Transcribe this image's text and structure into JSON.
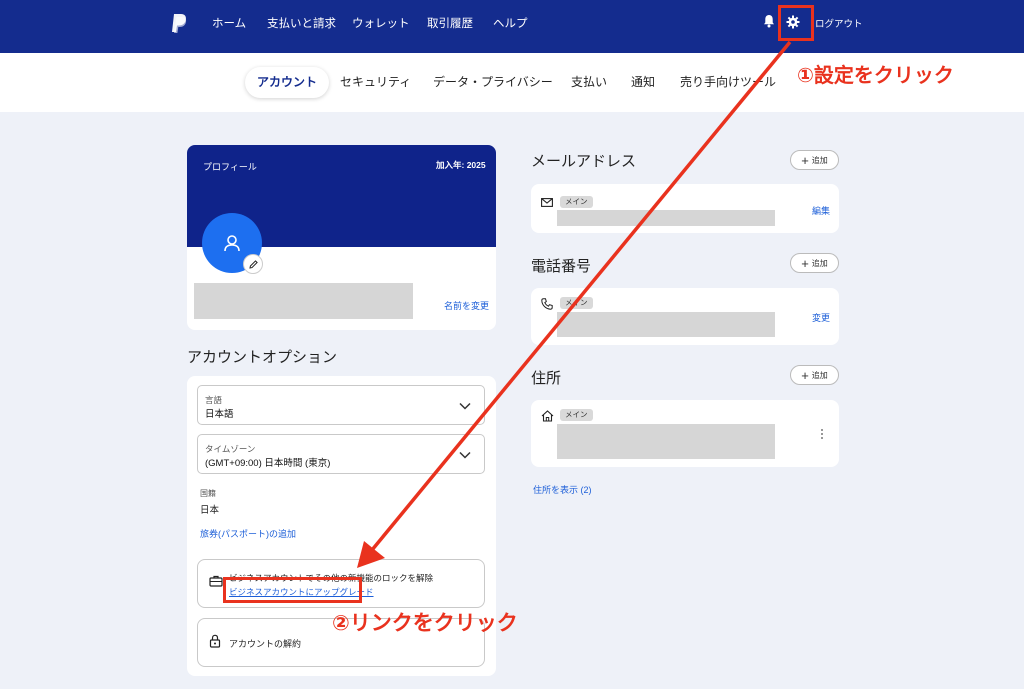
{
  "topnav": {
    "logo": "paypal-logo-icon",
    "items": [
      "ホーム",
      "支払いと請求",
      "ウォレット",
      "取引履歴",
      "ヘルプ"
    ],
    "logout": "ログアウト"
  },
  "tabs": [
    "アカウント",
    "セキュリティ",
    "データ・プライバシー",
    "支払い",
    "通知",
    "売り手向けツール"
  ],
  "profile": {
    "label": "プロフィール",
    "joined": "加入年: 2025",
    "change_name": "名前を変更"
  },
  "account_options": {
    "title": "アカウントオプション",
    "language_label": "言語",
    "language_value": "日本語",
    "timezone_label": "タイムゾーン",
    "timezone_value": "(GMT+09:00) 日本時間 (東京)",
    "country_label": "国籍",
    "country_value": "日本",
    "passport_link": "旅券(パスポート)の追加",
    "upgrade_text": "ビジネスアカウントでその他の新機能のロックを解除",
    "upgrade_link": "ビジネスアカウントにアップグレード",
    "close_account": "アカウントの解約"
  },
  "email": {
    "title": "メールアドレス",
    "add": "追加",
    "badge": "メイン",
    "edit": "編集"
  },
  "phone": {
    "title": "電話番号",
    "add": "追加",
    "badge": "メイン",
    "change": "変更"
  },
  "address": {
    "title": "住所",
    "add": "追加",
    "badge": "メイン",
    "show": "住所を表示 (2)"
  },
  "annotations": {
    "step1": "①設定をクリック",
    "step2": "②リンクをクリック",
    "color": "#e9321e"
  },
  "colors": {
    "topbar": "#142c8e",
    "profile_header": "#0f238a",
    "avatar": "#1d6ff0",
    "link": "#1d5fd8",
    "background": "#eef1f8"
  }
}
